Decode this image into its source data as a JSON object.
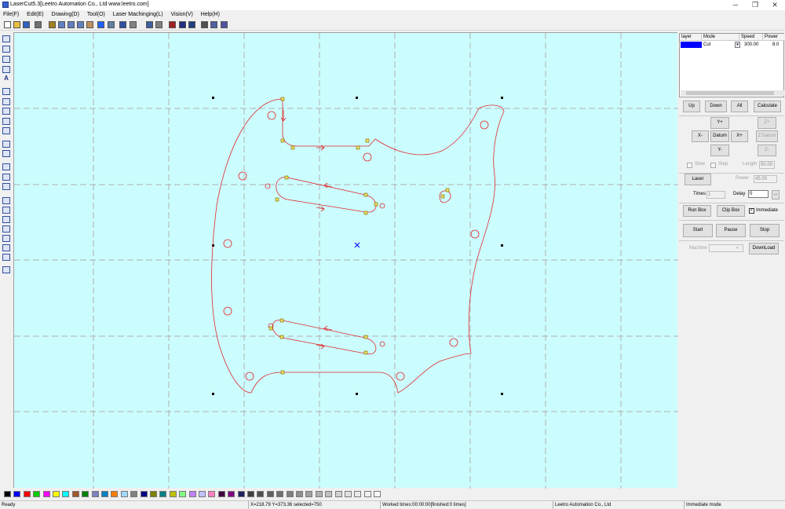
{
  "window": {
    "title": "LaserCut5.3[Leetro Automation Co., Ltd www.leetro.com]",
    "minimize": "─",
    "restore": "❐",
    "close": "✕"
  },
  "menu": [
    "File(F)",
    "Edit(E)",
    "Drawing(D)",
    "Tool(O)",
    "Laser Machinging(L)",
    "Vision(V)",
    "Help(H)"
  ],
  "toolbar_icons": [
    "new-file-icon",
    "open-folder-icon",
    "save-icon",
    "import-icon",
    "pen-icon",
    "zoom-window-icon",
    "zoom-in-icon",
    "zoom-out-icon",
    "pan-hand-icon",
    "zoom-fit-icon",
    "zoom-page-icon",
    "undo-icon",
    "redo-icon",
    "select-icon",
    "node-edit-icon",
    "arrow-icon",
    "line-tool-icon",
    "array-icon",
    "preview-icon",
    "zoom-selection-icon",
    "settings-icon"
  ],
  "left_tools": [
    "line-icon",
    "rectangle-icon",
    "polyline-icon",
    "ellipse-icon",
    "text-icon",
    "rotate-icon",
    "mirror-h-icon",
    "mirror-v-icon",
    "points-icon",
    "scale-icon",
    "group-icon",
    "ungroup-icon",
    "align-icon",
    "fill-icon",
    "curve-icon",
    "align-left-icon",
    "align-center-icon",
    "align-top-icon",
    "distribute-icon",
    "flip-icon",
    "center-icon",
    "array-icon",
    "layer-icon"
  ],
  "layers": {
    "headers": [
      "layer",
      "Mode",
      "Speed",
      "Power"
    ],
    "rows": [
      {
        "color": "#0000ff",
        "mode": "Cut",
        "speed": "300.00",
        "power": "8.0"
      }
    ]
  },
  "panel": {
    "up": "Up",
    "down": "Down",
    "all": "All",
    "calculate": "Calculate",
    "y_plus": "Y+",
    "x_minus": "X-",
    "datum": "Datum",
    "x_plus": "X+",
    "y_minus": "Y-",
    "z_plus": "Z+",
    "z_datum": "Z Datum",
    "z_minus": "Z-",
    "slow": "Slow",
    "step": "Step",
    "length_label": "Length",
    "length": "50.00",
    "laser": "Laser",
    "power_label": "Power",
    "power": "45.00",
    "times_label": "Times",
    "times": "1",
    "delay_label": "Delay",
    "delay": "0",
    "ellipsis": "...",
    "run_box": "Run Box",
    "clip_box": "Clip Box",
    "immediate": "Immediate",
    "immediate_checked": true,
    "start": "Start",
    "pause": "Pause",
    "stop": "Stop",
    "machine_label": "Machine",
    "machine": "",
    "download": "DownLoad"
  },
  "palette": [
    "#000000",
    "#0000ff",
    "#ff0000",
    "#00cc00",
    "#ff00ff",
    "#ffff00",
    "#00ffff",
    "#a05a2c",
    "#008000",
    "#8080c0",
    "#0080c0",
    "#ff8000",
    "#a0d8ff",
    "#808080",
    "#000080",
    "#808000",
    "#008080",
    "#c0c000",
    "#80ff80",
    "#c080ff",
    "#c0c0ff",
    "#ff80c0",
    "#400040",
    "#800080",
    "#202060",
    "#404040",
    "#505050",
    "#606060",
    "#707070",
    "#808080",
    "#909090",
    "#a0a0a0",
    "#b0b0b0",
    "#c0c0c0",
    "#d0d0d0",
    "#e0e0e0",
    "#e8e8e8",
    "#f0f0f0",
    "#f8f8f8"
  ],
  "status": {
    "ready": "Ready",
    "coords": "X=218.79 Y=373.36 selected=750",
    "worked": "Worked times:00:00:00[finished:0 times]",
    "company": "Leetro Automation Co., Ltd",
    "mode": "Immediate mode"
  }
}
